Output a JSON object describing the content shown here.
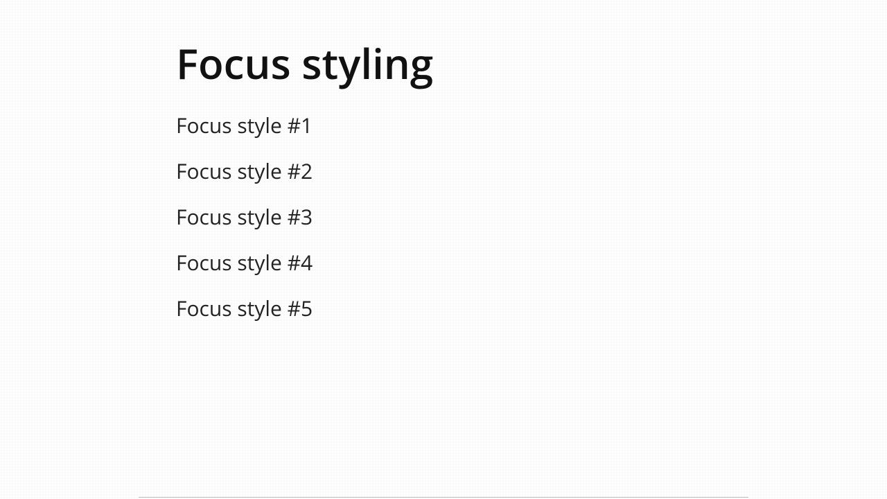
{
  "heading": "Focus styling",
  "links": [
    {
      "label": "Focus style #1"
    },
    {
      "label": "Focus style #2"
    },
    {
      "label": "Focus style #3"
    },
    {
      "label": "Focus style #4"
    },
    {
      "label": "Focus style #5"
    }
  ]
}
